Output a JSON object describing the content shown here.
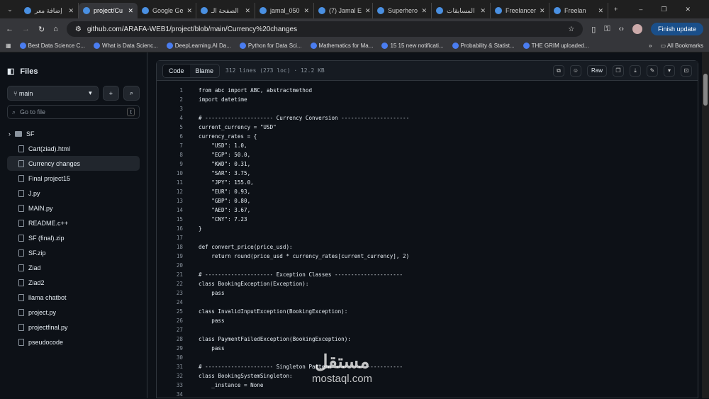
{
  "tabs": [
    {
      "label": "إضافة معر"
    },
    {
      "label": "project/Cu",
      "active": true
    },
    {
      "label": "Google Ge"
    },
    {
      "label": "الصفحة الـ"
    },
    {
      "label": "jamal_050"
    },
    {
      "label": "(7) Jamal E"
    },
    {
      "label": "Superhero"
    },
    {
      "label": "المسابقات"
    },
    {
      "label": "Freelancer"
    },
    {
      "label": "Freelan"
    }
  ],
  "address": {
    "url": "github.com/ARAFA-WEB1/project/blob/main/Currency%20changes",
    "finish_update": "Finish update"
  },
  "bookmarks": [
    "Best Data Science C...",
    "What is Data Scienc...",
    "DeepLearning.AI Da...",
    "Python for Data Sci...",
    "Mathematics for Ma...",
    "15 15 new notificati...",
    "Probability & Statist...",
    "THE GRIM uploaded..."
  ],
  "all_bookmarks": "All Bookmarks",
  "sidebar": {
    "title": "Files",
    "branch": "main",
    "search_placeholder": "Go to file",
    "search_key": "t",
    "items": [
      {
        "label": "SF",
        "type": "folder"
      },
      {
        "label": "Cart(ziad).html"
      },
      {
        "label": "Currency changes",
        "selected": true
      },
      {
        "label": "Final project15"
      },
      {
        "label": "J.py"
      },
      {
        "label": "MAIN.py"
      },
      {
        "label": "README.c++"
      },
      {
        "label": "SF (final).zip"
      },
      {
        "label": "SF.zip"
      },
      {
        "label": "Ziad"
      },
      {
        "label": "Ziad2"
      },
      {
        "label": "llama chatbot"
      },
      {
        "label": "project.py"
      },
      {
        "label": "projectfinal.py"
      },
      {
        "label": "pseudocode"
      }
    ]
  },
  "file": {
    "tab_code": "Code",
    "tab_blame": "Blame",
    "meta": "312 lines (273 loc) · 12.2 KB",
    "raw": "Raw",
    "lines": [
      "from abc import ABC, abstractmethod",
      "import datetime",
      "",
      "# --------------------- Currency Conversion ---------------------",
      "current_currency = \"USD\"",
      "currency_rates = {",
      "    \"USD\": 1.0,",
      "    \"EGP\": 50.0,",
      "    \"KWD\": 0.31,",
      "    \"SAR\": 3.75,",
      "    \"JPY\": 155.0,",
      "    \"EUR\": 0.93,",
      "    \"GBP\": 0.80,",
      "    \"AED\": 3.67,",
      "    \"CNY\": 7.23",
      "}",
      "",
      "def convert_price(price_usd):",
      "    return round(price_usd * currency_rates[current_currency], 2)",
      "",
      "# --------------------- Exception Classes ---------------------",
      "class BookingException(Exception):",
      "    pass",
      "",
      "class InvalidInputException(BookingException):",
      "    pass",
      "",
      "class PaymentFailedException(BookingException):",
      "    pass",
      "",
      "# --------------------- Singleton Pattern ---------------------",
      "class BookingSystemSingleton:",
      "    _instance = None",
      ""
    ]
  },
  "watermark": {
    "text": "مستقل",
    "domain": "mostaql.com"
  }
}
